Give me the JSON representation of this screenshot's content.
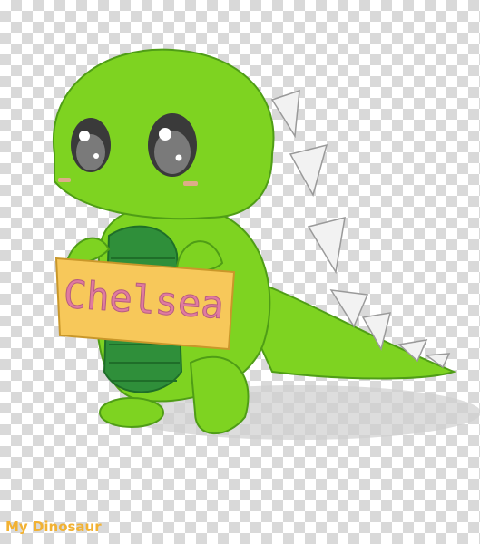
{
  "sign": {
    "text": "Chelsea"
  },
  "watermark": {
    "text": "My Dinosaur"
  },
  "colors": {
    "body": "#7ed321",
    "body_dark": "#4f9d16",
    "belly": "#2f8f3a",
    "belly_stripe": "#1f6e29",
    "spike": "#f2f2f2",
    "sign_fill": "#f7c85a",
    "sign_text": "#e07aa0",
    "blush": "#f5a3a3",
    "eye": "#3a3a3a"
  }
}
